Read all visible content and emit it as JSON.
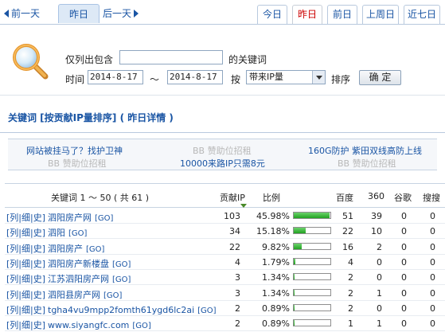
{
  "daynav": {
    "prev_label": "前一天",
    "current_label": "昨日",
    "next_label": "后一天"
  },
  "tabs": [
    {
      "label": "今日",
      "active": false
    },
    {
      "label": "昨日",
      "active": true
    },
    {
      "label": "前日",
      "active": false
    },
    {
      "label": "上周日",
      "active": false
    },
    {
      "label": "近七日",
      "active": false
    }
  ],
  "filter": {
    "only_list_label": "仅列出包含",
    "keyword_suffix": "的关键词",
    "keyword_value": "",
    "time_label": "时间",
    "date_from": "2014-8-17",
    "range_sep": "～",
    "date_to": "2014-8-17",
    "by_label": "按",
    "sort_field": "带来IP量",
    "sort_label": "排序",
    "confirm_label": "确 定"
  },
  "heading": "关键词 [按贡献IP量排序] ( 昨日详情 )",
  "ads": {
    "items": [
      {
        "text": "网站被挂马了？找护卫神",
        "kind": "link"
      },
      {
        "text": "BB 赞助位招租",
        "kind": "muted"
      },
      {
        "text": "160G防护 紫田双线高防上线",
        "kind": "link"
      },
      {
        "text": "BB 赞助位招租",
        "kind": "muted"
      },
      {
        "text": "10000来路IP只需8元",
        "kind": "link"
      },
      {
        "text": "BB 赞助位招租",
        "kind": "muted"
      }
    ]
  },
  "table": {
    "headers": {
      "keyword": "关键词 1 ～ 50 ( 共 61 )",
      "ip": "贡献IP",
      "ratio": "比例",
      "baidu": "百度",
      "s360": "360",
      "google": "谷歌",
      "sogou": "搜搜"
    },
    "row_link_prefix": [
      "[列",
      "|细",
      "|史]"
    ],
    "go_label": "[GO]",
    "rows": [
      {
        "keyword": "泗阳房产网",
        "ip": "103",
        "ratio": "45.98%",
        "ratio_value": 45.98,
        "baidu": "51",
        "s360": "39",
        "google": "0",
        "sogou": "0"
      },
      {
        "keyword": "泗阳",
        "ip": "34",
        "ratio": "15.18%",
        "ratio_value": 15.18,
        "baidu": "22",
        "s360": "10",
        "google": "0",
        "sogou": "0"
      },
      {
        "keyword": "泗阳房产",
        "ip": "22",
        "ratio": "9.82%",
        "ratio_value": 9.82,
        "baidu": "16",
        "s360": "2",
        "google": "0",
        "sogou": "0"
      },
      {
        "keyword": "泗阳房产新楼盘",
        "ip": "4",
        "ratio": "1.79%",
        "ratio_value": 1.79,
        "baidu": "4",
        "s360": "0",
        "google": "0",
        "sogou": "0"
      },
      {
        "keyword": "江苏泗阳房产网",
        "ip": "3",
        "ratio": "1.34%",
        "ratio_value": 1.34,
        "baidu": "2",
        "s360": "0",
        "google": "0",
        "sogou": "0"
      },
      {
        "keyword": "泗阳县房产网",
        "ip": "3",
        "ratio": "1.34%",
        "ratio_value": 1.34,
        "baidu": "2",
        "s360": "1",
        "google": "0",
        "sogou": "0"
      },
      {
        "keyword": "tgha4vu9mpp2fomth61ygd6lc2ai",
        "ip": "2",
        "ratio": "0.89%",
        "ratio_value": 0.89,
        "baidu": "2",
        "s360": "0",
        "google": "0",
        "sogou": "0"
      },
      {
        "keyword": "www.siyangfc.com",
        "ip": "2",
        "ratio": "0.89%",
        "ratio_value": 0.89,
        "baidu": "1",
        "s360": "1",
        "google": "0",
        "sogou": "0"
      }
    ]
  },
  "colors": {
    "link": "#1a55a4",
    "active_tab": "#cc0000",
    "bar_fill": "#21a121"
  }
}
